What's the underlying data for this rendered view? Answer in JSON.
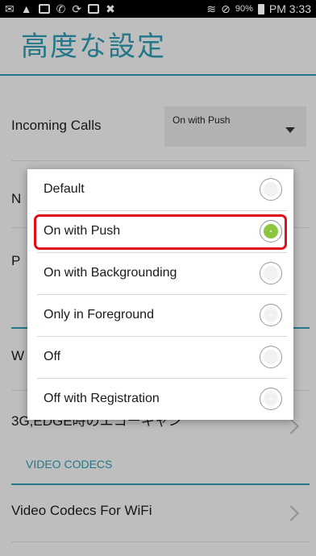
{
  "status_bar": {
    "battery": "90%",
    "time": "PM 3:33"
  },
  "header": {
    "title": "高度な設定"
  },
  "settings": {
    "incoming_calls_label": "Incoming Calls",
    "incoming_calls_value": "On with Push",
    "partial_n": "N",
    "partial_p": "P",
    "partial_w": "W",
    "row_3g_partial": "3G,EDGE時のエコーキャン",
    "section_video_codecs": "VIDEO CODECS",
    "video_codecs_wifi_label": "Video Codecs For WiFi"
  },
  "dialog": {
    "options": [
      {
        "label": "Default",
        "checked": false
      },
      {
        "label": "On with Push",
        "checked": true
      },
      {
        "label": "On with Backgrounding",
        "checked": false
      },
      {
        "label": "Only in Foreground",
        "checked": false
      },
      {
        "label": "Off",
        "checked": false
      },
      {
        "label": "Off with Registration",
        "checked": false
      }
    ]
  },
  "colors": {
    "accent": "#2a93a9",
    "radio_selected": "#8cc63f",
    "highlight_border": "#e0101a"
  }
}
